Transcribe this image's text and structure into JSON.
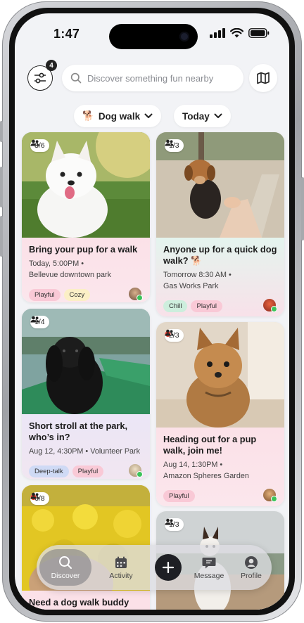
{
  "status": {
    "time": "1:47"
  },
  "topbar": {
    "filter_count": "4",
    "search_placeholder": "Discover something fun nearby"
  },
  "chips": {
    "activity": {
      "emoji": "🐕",
      "label": "Dog walk"
    },
    "when": {
      "label": "Today"
    }
  },
  "cards": [
    {
      "count": "3/6",
      "hot": false,
      "title": "Bring your pup for a walk",
      "time": "Today, 5:00PM •",
      "place": "Bellevue downtown park",
      "tags": [
        "Playful",
        "Cozy"
      ]
    },
    {
      "count": "1/3",
      "hot": false,
      "title": "Anyone up for a quick dog walk? 🐕",
      "time": "Tomorrow 8:30 AM •",
      "place": "Gas Works Park",
      "tags": [
        "Chill",
        "Playful"
      ]
    },
    {
      "count": "1/4",
      "hot": false,
      "title": "Short stroll at the park, who’s in?",
      "time": "Aug 12, 4:30PM • Volunteer Park",
      "place": "",
      "tags": [
        "Deep-talk",
        "Playful"
      ]
    },
    {
      "count": "2/3",
      "hot": true,
      "title": "Heading out for a pup walk, join me!",
      "time": "Aug 14, 1:30PM •",
      "place": "Amazon Spheres Garden",
      "tags": [
        "Playful"
      ]
    },
    {
      "count": "6/8",
      "hot": true,
      "title": "Need a dog walk buddy for",
      "time": "",
      "place": "",
      "tags": []
    },
    {
      "count": "1/3",
      "hot": false,
      "title": "",
      "time": "",
      "place": "",
      "tags": []
    }
  ],
  "nav": {
    "items": [
      {
        "label": "Discover",
        "icon": "search-icon"
      },
      {
        "label": "Activity",
        "icon": "calendar-icon"
      },
      {
        "label": "",
        "icon": "plus-icon"
      },
      {
        "label": "Message",
        "icon": "message-icon"
      },
      {
        "label": "Profile",
        "icon": "profile-icon"
      }
    ]
  },
  "colors": {
    "card_pink": "#fbe1e8",
    "card_mint": "#e4f4ee",
    "card_lavender": "#ebe6f6",
    "tag_pink": "#f9c9d6",
    "tag_yellow": "#fbefc6",
    "tag_green": "#cdeedd",
    "tag_blue": "#cfdaf5"
  }
}
